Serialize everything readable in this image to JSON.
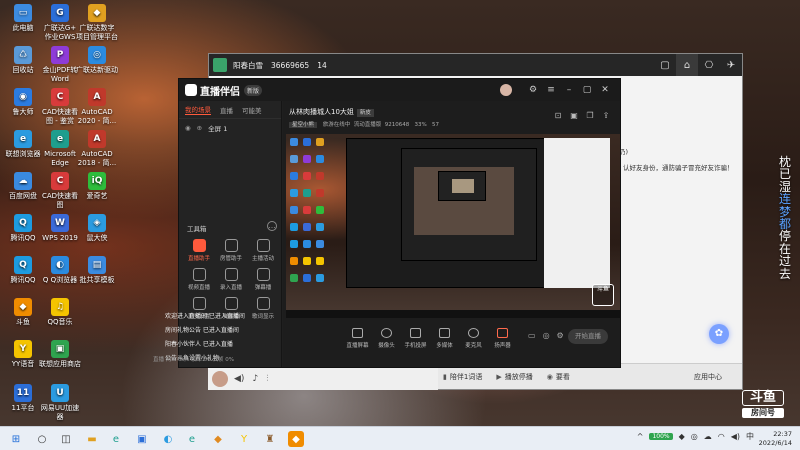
{
  "desktop_icons": [
    {
      "label": "此电脑",
      "color": "#3c8be0",
      "glyph": "▭"
    },
    {
      "label": "广联达G+\n作业GWS",
      "color": "#2b6ed8",
      "glyph": "G"
    },
    {
      "label": "广联达数字\n项目管理平台",
      "color": "#e0a020",
      "glyph": "◆"
    },
    {
      "label": "回收站",
      "color": "#5a9ad8",
      "glyph": "♺"
    },
    {
      "label": "金山PDF转\nWord",
      "color": "#8e3bd8",
      "glyph": "P"
    },
    {
      "label": "广联达新驱动",
      "color": "#2b8be0",
      "glyph": "◎"
    },
    {
      "label": "鲁大师",
      "color": "#2b7be0",
      "glyph": "◉"
    },
    {
      "label": "CAD快速看\n图 - 鉴赏",
      "color": "#d83b3b",
      "glyph": "C"
    },
    {
      "label": "AutoCAD\n2020 - 简...",
      "color": "#c0392b",
      "glyph": "A"
    },
    {
      "label": "联想浏览器",
      "color": "#2b9be0",
      "glyph": "e"
    },
    {
      "label": "Microsoft\nEdge",
      "color": "#1e9e8e",
      "glyph": "e"
    },
    {
      "label": "AutoCAD\n2018 - 简...",
      "color": "#c0392b",
      "glyph": "A"
    },
    {
      "label": "百度网盘",
      "color": "#3a8ae0",
      "glyph": "☁"
    },
    {
      "label": "CAD快速看\n图",
      "color": "#d83b3b",
      "glyph": "C"
    },
    {
      "label": "爱奇艺",
      "color": "#2ebd3c",
      "glyph": "iQ"
    },
    {
      "label": "腾讯QQ",
      "color": "#1d9be0",
      "glyph": "Q"
    },
    {
      "label": "WPS 2019",
      "color": "#3b6ad8",
      "glyph": "W"
    },
    {
      "label": "鼠大侠",
      "color": "#2b9be0",
      "glyph": "◈"
    },
    {
      "label": "腾讯QQ",
      "color": "#1d9be0",
      "glyph": "Q"
    },
    {
      "label": "Q Q浏览器",
      "color": "#2b8be0",
      "glyph": "◐"
    },
    {
      "label": "批共享模板",
      "color": "#3b8be0",
      "glyph": "▤"
    },
    {
      "label": "斗鱼",
      "color": "#f08c00",
      "glyph": "◆"
    },
    {
      "label": "QQ音乐",
      "color": "#f5c400",
      "glyph": "♫"
    },
    {
      "label": "YY语音",
      "color": "#f5c400",
      "glyph": "Y"
    },
    {
      "label": "联想应用商店",
      "color": "#2fa44f",
      "glyph": "▣"
    },
    {
      "label": "11平台",
      "color": "#2b6ed8",
      "glyph": "11"
    },
    {
      "label": "网易UU加速\n器",
      "color": "#2b9be0",
      "glyph": "U"
    }
  ],
  "right_vertical_text": {
    "before": "枕已湿",
    "accent": "连梦都",
    "after": "停在过去"
  },
  "back_window": {
    "room_name": "阳春白雪",
    "room_id": "36669665",
    "viewers": "14",
    "body_line_1": "仍)",
    "body_line_2": "认好友身份，通防骗子冒充好友诈骗！",
    "bottom_bar": {
      "items": [
        "陪伴1词语",
        "播放停播",
        "要看"
      ],
      "app_use": "应用中心"
    }
  },
  "front_window": {
    "logo": "直播伴侣",
    "version": "新版",
    "tabs": [
      "我的场景",
      "直播",
      "可能美"
    ],
    "scene_item": "全屏 1",
    "toolbox_label": "工具箱",
    "tools": [
      {
        "label": "直播助手",
        "active": true
      },
      {
        "label": "房管助手",
        "active": false
      },
      {
        "label": "主播活动",
        "active": false
      },
      {
        "label": "视频直播",
        "active": false
      },
      {
        "label": "录入直播",
        "active": false
      },
      {
        "label": "弹幕播",
        "active": false
      },
      {
        "label": "更多设置",
        "active": false
      },
      {
        "label": "弹幕姬",
        "active": false
      },
      {
        "label": "歌词显示",
        "active": false
      }
    ],
    "chat_lines": [
      "欢迎进入直播间 已进入直播间",
      "房间礼物公告 已进入直播间",
      "阳春小伙伴人 已进入直播",
      "公告斗鱼设置小礼物"
    ],
    "status_line": "直播 网lo 0k/s  帧率 50  丢帧 0%",
    "room_title": "从林肉播城人10大姐",
    "room_tag": "新皮",
    "room_meta": {
      "badge": "星空小熊",
      "category": "旅游在线中",
      "stream": "流动直播版",
      "room": "9210648",
      "fps": "33%",
      "count": "57"
    },
    "bottom_tools": [
      "直播屏幕",
      "摄像头",
      "手机投屏",
      "多媒体",
      "麦克风",
      "扬声器"
    ],
    "start_button": "开始直播"
  },
  "watermark": {
    "top": "斗鱼",
    "bottom": "房间号",
    "sub": "36669665"
  },
  "taskbar": {
    "clock_time": "22:37",
    "clock_date": "2022/6/14",
    "battery": "100%"
  }
}
